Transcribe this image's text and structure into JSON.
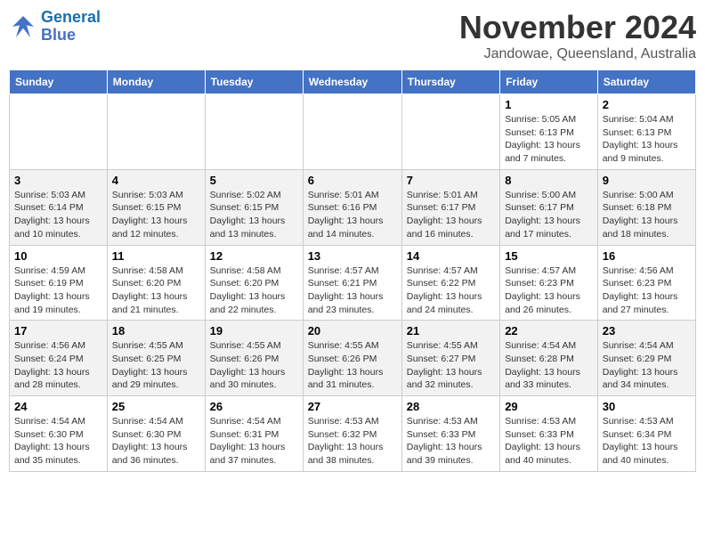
{
  "header": {
    "logo_line1": "General",
    "logo_line2": "Blue",
    "month": "November 2024",
    "location": "Jandowae, Queensland, Australia"
  },
  "weekdays": [
    "Sunday",
    "Monday",
    "Tuesday",
    "Wednesday",
    "Thursday",
    "Friday",
    "Saturday"
  ],
  "weeks": [
    [
      {
        "day": "",
        "info": ""
      },
      {
        "day": "",
        "info": ""
      },
      {
        "day": "",
        "info": ""
      },
      {
        "day": "",
        "info": ""
      },
      {
        "day": "",
        "info": ""
      },
      {
        "day": "1",
        "info": "Sunrise: 5:05 AM\nSunset: 6:13 PM\nDaylight: 13 hours and 7 minutes."
      },
      {
        "day": "2",
        "info": "Sunrise: 5:04 AM\nSunset: 6:13 PM\nDaylight: 13 hours and 9 minutes."
      }
    ],
    [
      {
        "day": "3",
        "info": "Sunrise: 5:03 AM\nSunset: 6:14 PM\nDaylight: 13 hours and 10 minutes."
      },
      {
        "day": "4",
        "info": "Sunrise: 5:03 AM\nSunset: 6:15 PM\nDaylight: 13 hours and 12 minutes."
      },
      {
        "day": "5",
        "info": "Sunrise: 5:02 AM\nSunset: 6:15 PM\nDaylight: 13 hours and 13 minutes."
      },
      {
        "day": "6",
        "info": "Sunrise: 5:01 AM\nSunset: 6:16 PM\nDaylight: 13 hours and 14 minutes."
      },
      {
        "day": "7",
        "info": "Sunrise: 5:01 AM\nSunset: 6:17 PM\nDaylight: 13 hours and 16 minutes."
      },
      {
        "day": "8",
        "info": "Sunrise: 5:00 AM\nSunset: 6:17 PM\nDaylight: 13 hours and 17 minutes."
      },
      {
        "day": "9",
        "info": "Sunrise: 5:00 AM\nSunset: 6:18 PM\nDaylight: 13 hours and 18 minutes."
      }
    ],
    [
      {
        "day": "10",
        "info": "Sunrise: 4:59 AM\nSunset: 6:19 PM\nDaylight: 13 hours and 19 minutes."
      },
      {
        "day": "11",
        "info": "Sunrise: 4:58 AM\nSunset: 6:20 PM\nDaylight: 13 hours and 21 minutes."
      },
      {
        "day": "12",
        "info": "Sunrise: 4:58 AM\nSunset: 6:20 PM\nDaylight: 13 hours and 22 minutes."
      },
      {
        "day": "13",
        "info": "Sunrise: 4:57 AM\nSunset: 6:21 PM\nDaylight: 13 hours and 23 minutes."
      },
      {
        "day": "14",
        "info": "Sunrise: 4:57 AM\nSunset: 6:22 PM\nDaylight: 13 hours and 24 minutes."
      },
      {
        "day": "15",
        "info": "Sunrise: 4:57 AM\nSunset: 6:23 PM\nDaylight: 13 hours and 26 minutes."
      },
      {
        "day": "16",
        "info": "Sunrise: 4:56 AM\nSunset: 6:23 PM\nDaylight: 13 hours and 27 minutes."
      }
    ],
    [
      {
        "day": "17",
        "info": "Sunrise: 4:56 AM\nSunset: 6:24 PM\nDaylight: 13 hours and 28 minutes."
      },
      {
        "day": "18",
        "info": "Sunrise: 4:55 AM\nSunset: 6:25 PM\nDaylight: 13 hours and 29 minutes."
      },
      {
        "day": "19",
        "info": "Sunrise: 4:55 AM\nSunset: 6:26 PM\nDaylight: 13 hours and 30 minutes."
      },
      {
        "day": "20",
        "info": "Sunrise: 4:55 AM\nSunset: 6:26 PM\nDaylight: 13 hours and 31 minutes."
      },
      {
        "day": "21",
        "info": "Sunrise: 4:55 AM\nSunset: 6:27 PM\nDaylight: 13 hours and 32 minutes."
      },
      {
        "day": "22",
        "info": "Sunrise: 4:54 AM\nSunset: 6:28 PM\nDaylight: 13 hours and 33 minutes."
      },
      {
        "day": "23",
        "info": "Sunrise: 4:54 AM\nSunset: 6:29 PM\nDaylight: 13 hours and 34 minutes."
      }
    ],
    [
      {
        "day": "24",
        "info": "Sunrise: 4:54 AM\nSunset: 6:30 PM\nDaylight: 13 hours and 35 minutes."
      },
      {
        "day": "25",
        "info": "Sunrise: 4:54 AM\nSunset: 6:30 PM\nDaylight: 13 hours and 36 minutes."
      },
      {
        "day": "26",
        "info": "Sunrise: 4:54 AM\nSunset: 6:31 PM\nDaylight: 13 hours and 37 minutes."
      },
      {
        "day": "27",
        "info": "Sunrise: 4:53 AM\nSunset: 6:32 PM\nDaylight: 13 hours and 38 minutes."
      },
      {
        "day": "28",
        "info": "Sunrise: 4:53 AM\nSunset: 6:33 PM\nDaylight: 13 hours and 39 minutes."
      },
      {
        "day": "29",
        "info": "Sunrise: 4:53 AM\nSunset: 6:33 PM\nDaylight: 13 hours and 40 minutes."
      },
      {
        "day": "30",
        "info": "Sunrise: 4:53 AM\nSunset: 6:34 PM\nDaylight: 13 hours and 40 minutes."
      }
    ]
  ]
}
